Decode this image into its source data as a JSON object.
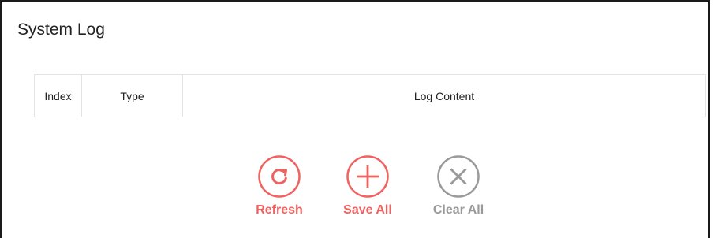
{
  "title": "System Log",
  "table": {
    "columns": [
      "Index",
      "Type",
      "Log Content"
    ],
    "rows": []
  },
  "actions": {
    "refresh": {
      "label": "Refresh",
      "icon": "refresh-icon",
      "color": "#f0615f"
    },
    "save_all": {
      "label": "Save All",
      "icon": "plus-icon",
      "color": "#f0615f"
    },
    "clear_all": {
      "label": "Clear All",
      "icon": "close-icon",
      "color": "#9a9a9a"
    }
  }
}
